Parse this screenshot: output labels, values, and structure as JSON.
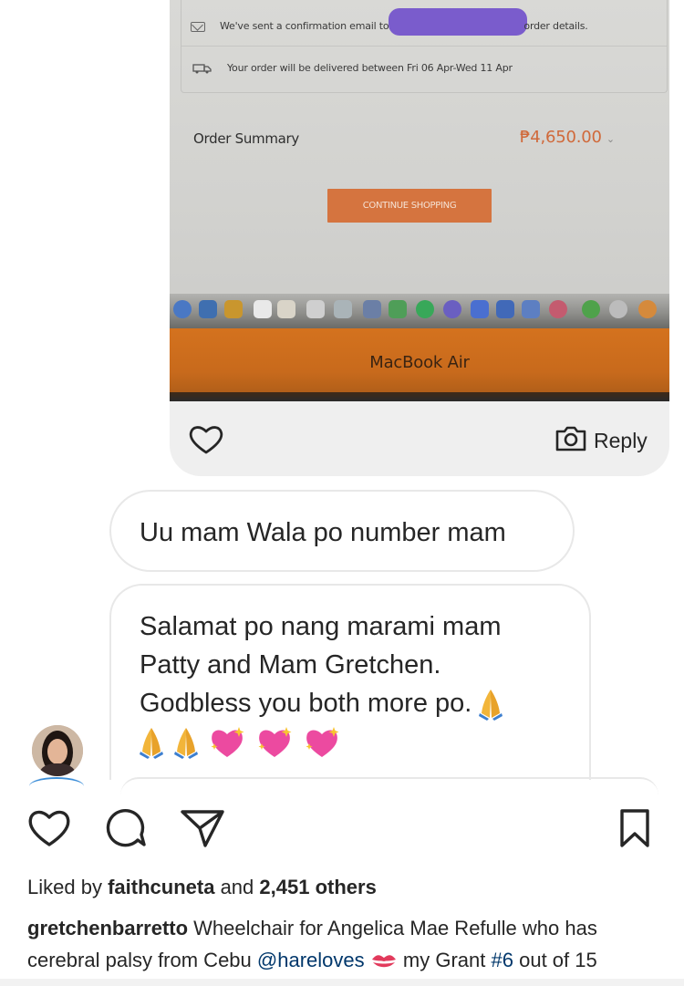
{
  "photo": {
    "email_notice_prefix": "We've sent a confirmation email to",
    "email_notice_suffix": "order details.",
    "delivery_notice": "Your order will be delivered between Fri 06 Apr-Wed 11 Apr",
    "order_summary_label": "Order Summary",
    "order_total": "₱4,650.00",
    "continue_button": "CONTINUE SHOPPING",
    "laptop_label": "MacBook Air",
    "icons": [
      "mail-icon",
      "truck-icon",
      "chevron-down-icon"
    ],
    "accent_color": "#d5743f",
    "redaction_color": "#7a5ccc"
  },
  "photo_actions": {
    "reply_label": "Reply",
    "icons": [
      "heart-outline-icon",
      "camera-icon"
    ]
  },
  "messages": [
    {
      "lines": [
        "Uu mam Wala po number mam"
      ]
    },
    {
      "lines": [
        "Salamat po nang marami mam",
        "Patty and Mam Gretchen.",
        "Godbless you both more po."
      ],
      "emoji": [
        "folded-hands",
        "folded-hands",
        "folded-hands",
        "sparkling-heart",
        "sparkling-heart",
        "sparkling-heart"
      ]
    }
  ],
  "post": {
    "liked_by_prefix": "Liked by",
    "liked_by_user": "faithcuneta",
    "liked_by_and": "and",
    "liked_by_count": "2,451 others",
    "caption_user": "gretchenbarretto",
    "caption_text_1": "Wheelchair for Angelica Mae Refulle who has cerebral palsy from Cebu",
    "caption_mention": "@hareloves",
    "caption_text_2": "my Grant",
    "caption_hashtag": "#6",
    "caption_text_3": "out of 15",
    "icons": [
      "like-icon",
      "comment-icon",
      "share-icon",
      "save-icon"
    ],
    "link_color": "#00376b"
  }
}
